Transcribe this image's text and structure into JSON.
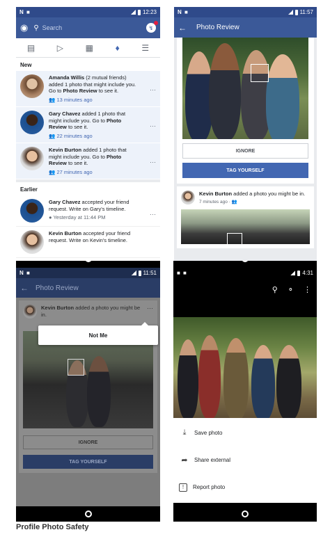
{
  "phone1": {
    "status_left": "N ■",
    "time": "12:23",
    "search_placeholder": "Search",
    "section_new": "New",
    "section_earlier": "Earlier",
    "notifications": [
      {
        "name": "Amanda Willis",
        "pre": "",
        "text_a": " (2 mutual friends) added 1 photo that might include you. Go to ",
        "link": "Photo Review",
        "text_b": " to see it.",
        "time": "13 minutes ago"
      },
      {
        "name": "Gary Chavez",
        "text_a": " added 1 photo that might include you. Go to ",
        "link": "Photo Review",
        "text_b": " to see it.",
        "time": "22 minutes ago"
      },
      {
        "name": "Kevin Burton",
        "text_a": " added 1 photo that might include you. Go to ",
        "link": "Photo Review",
        "text_b": " to see it.",
        "time": "27 minutes ago"
      }
    ],
    "earlier": [
      {
        "name": "Gary Chavez",
        "text": " accepted your friend request. Write on Gary's timeline.",
        "time": "Yesterday at 11:44 PM"
      },
      {
        "name": "Kevin Burton",
        "text": " accepted your friend request. Write on Kevin's timeline."
      }
    ]
  },
  "phone2": {
    "time": "11:57",
    "title": "Photo Review",
    "ignore": "IGNORE",
    "tag": "TAG YOURSELF",
    "post_name": "Kevin Burton",
    "post_text": " added a photo you might be in.",
    "post_time": "7 minutes ago"
  },
  "phone3": {
    "time": "11:51",
    "title": "Photo Review",
    "post_name": "Kevin Burton",
    "post_text": " added a photo you might be in.",
    "popup": "Not Me",
    "ignore": "IGNORE",
    "tag": "TAG YOURSELF"
  },
  "phone4": {
    "time": "4:31",
    "menu": [
      "Save photo",
      "Share external",
      "Report photo"
    ]
  },
  "caption": "Profile Photo Safety",
  "colors": {
    "fb_blue": "#3b5998",
    "link": "#4267b2"
  }
}
